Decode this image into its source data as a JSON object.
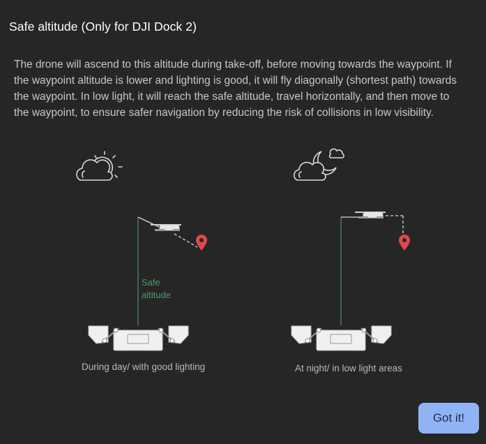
{
  "dialog": {
    "title": "Safe altitude (Only for DJI Dock 2)",
    "description": "The drone will ascend to this altitude during take-off, before moving towards the waypoint. If the waypoint altitude is lower and lighting is good, it will fly diagonally (shortest path) towards the waypoint. In low light, it will reach the safe altitude, travel horizontally, and then move to the waypoint, to ensure safer navigation by reducing the risk of collisions in low visibility.",
    "safe_altitude_label_line1": "Safe",
    "safe_altitude_label_line2": "altitude",
    "caption_day": "During day/ with good lighting",
    "caption_night": "At night/ in low light areas",
    "confirm_button": "Got it!"
  },
  "colors": {
    "background": "#262626",
    "path_line": "#3f7a58",
    "safe_label": "#4f9a6d",
    "waypoint_marker": "#e0484d",
    "button_bg": "#8fb3f5"
  },
  "icons": [
    "cloudy-sun-icon",
    "night-moon-cloud-icon",
    "drone-icon",
    "waypoint-marker-icon",
    "dock-icon"
  ]
}
